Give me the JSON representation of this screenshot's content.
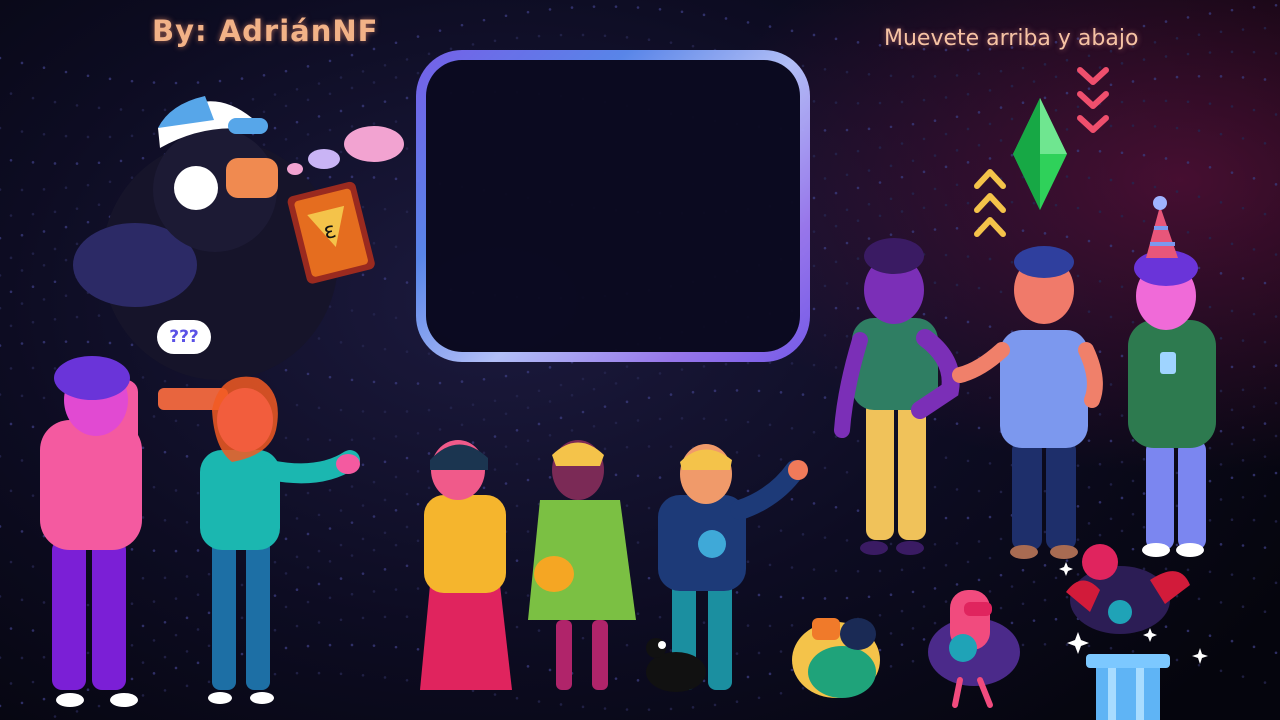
{
  "overlay": {
    "credit": "By: AdriánNF",
    "hint": "Muevete arriba y abajo",
    "question_bubble": "???"
  },
  "colors": {
    "credit": "#f2b287",
    "hint": "#f6c3a4",
    "frame_gradient": [
      "#7a63f0",
      "#5c8af0",
      "#b9c6ff",
      "#9d7bf2"
    ],
    "plumbob": "#2fd15a",
    "up_arrows": "#f4c34a",
    "down_arrows": "#ef4f6d"
  },
  "icons": [
    "plumbob-icon",
    "chevron-up-icon",
    "chevron-down-icon",
    "thought-bubble-icon",
    "sparkle-icon"
  ]
}
